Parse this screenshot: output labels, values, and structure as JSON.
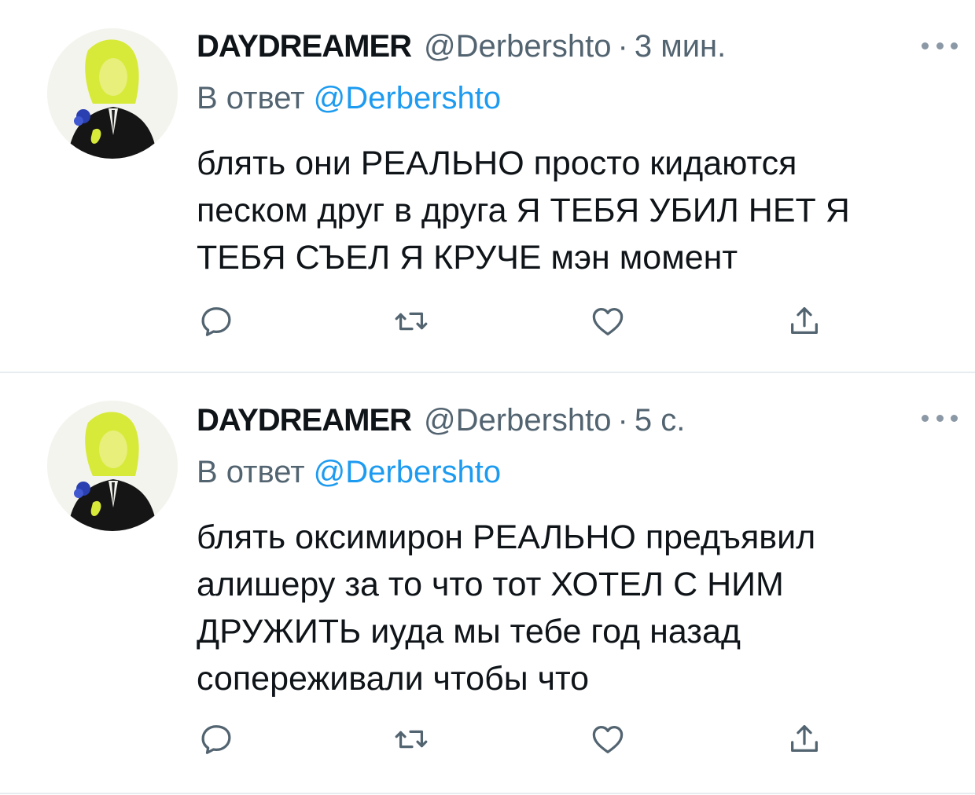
{
  "colors": {
    "text_primary": "#0f1419",
    "text_secondary": "#536471",
    "link": "#1d9bf0",
    "icon": "#536471",
    "divider": "#e6ecf0"
  },
  "tweets": [
    {
      "display_name": "DAYDREAMER",
      "handle": "@Derbershto",
      "separator": "·",
      "time": "3 мин.",
      "reply_prefix": "В ответ",
      "reply_to": "@Derbershto",
      "text": "блять они РЕАЛЬНО просто кидаются\nпеском друг в друга Я ТЕБЯ УБИЛ НЕТ Я\nТЕБЯ СЪЕЛ Я КРУЧЕ мэн момент",
      "icons": [
        "reply-icon",
        "retweet-icon",
        "like-icon",
        "share-icon"
      ]
    },
    {
      "display_name": "DAYDREAMER",
      "handle": "@Derbershto",
      "separator": "·",
      "time": "5 с.",
      "reply_prefix": "В ответ",
      "reply_to": "@Derbershto",
      "text": "блять оксимирон РЕАЛЬНО предъявил\nалишеру за то что тот ХОТЕЛ С НИМ\nДРУЖИТЬ иуда мы тебе год назад\nсопереживали чтобы что",
      "icons": [
        "reply-icon",
        "retweet-icon",
        "like-icon",
        "share-icon"
      ]
    }
  ]
}
